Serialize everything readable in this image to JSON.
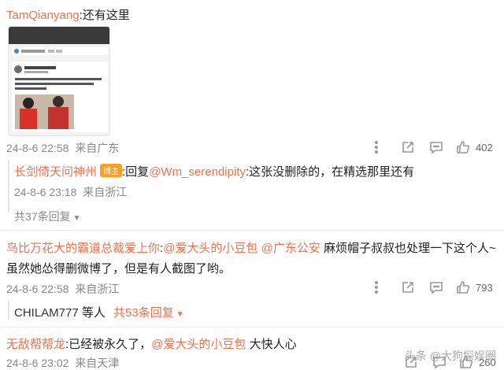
{
  "comment1": {
    "username": "TamQianyang",
    "text": ":还有这里",
    "time": "24-8-6 22:58",
    "source": "来自广东",
    "likes": "402",
    "reply": {
      "username": "长剑倚天问神州",
      "badge": "博主",
      "prefix": ":回复",
      "mention": "@Wm_serendipity",
      "text": ":这张没删除的，在精选那里还有",
      "time": "24-8-6 23:18",
      "source": "来自浙江"
    },
    "more_replies": "共37条回复"
  },
  "comment2": {
    "username": "鸟比万花大的霸道总裁爱上你",
    "colon": ":",
    "mention1": "@爱大头的小豆包",
    "mention2": "@广东公安",
    "text1": " 麻烦帽子叔叔也处理一下这个人~",
    "text2": "虽然她怂得删微博了，但是有人截图了哟。",
    "time": "24-8-6 22:58",
    "source": "来自浙江",
    "likes": "793",
    "replier": "CHILAM777",
    "replier_suffix": " 等人",
    "more_replies": "共53条回复"
  },
  "comment3": {
    "username": "无敌帮帮龙",
    "text1": ":已经被永久了，",
    "mention": "@爱大头的小豆包",
    "text2": " 大快人心",
    "time": "24-8-6 23:02",
    "source": "来自天津",
    "likes": "260"
  },
  "watermark": "头条 @大狗探娱圈",
  "colors": {
    "accent": "#eb7350",
    "meta": "#888888",
    "badge": "#f7a028"
  }
}
